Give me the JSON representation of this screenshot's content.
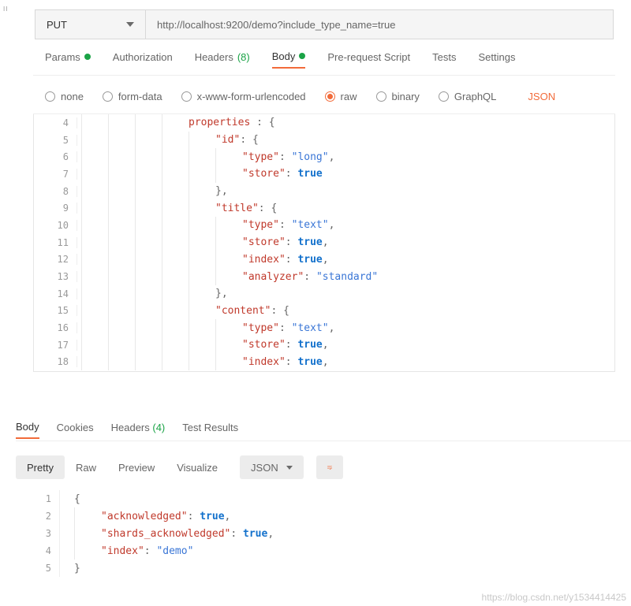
{
  "request": {
    "method": "PUT",
    "url": "http://localhost:9200/demo?include_type_name=true"
  },
  "tabs": {
    "params": "Params",
    "auth": "Authorization",
    "headers": "Headers",
    "headers_count": "(8)",
    "body": "Body",
    "prerequest": "Pre-request Script",
    "tests": "Tests",
    "settings": "Settings"
  },
  "body_type": {
    "none": "none",
    "formdata": "form-data",
    "xwww": "x-www-form-urlencoded",
    "raw": "raw",
    "binary": "binary",
    "graphql": "GraphQL",
    "format": "JSON"
  },
  "req_code": {
    "l4": {
      "n": "4",
      "ind": 4,
      "t": [
        [
          "k",
          "properties"
        ],
        [
          "p",
          " : {"
        ]
      ]
    },
    "l5": {
      "n": "5",
      "ind": 5,
      "t": [
        [
          "k",
          "\"id\""
        ],
        [
          "p",
          ": {"
        ]
      ]
    },
    "l6": {
      "n": "6",
      "ind": 6,
      "t": [
        [
          "k",
          "\"type\""
        ],
        [
          "p",
          ": "
        ],
        [
          "s",
          "\"long\""
        ],
        [
          "p",
          ","
        ]
      ]
    },
    "l7": {
      "n": "7",
      "ind": 6,
      "t": [
        [
          "k",
          "\"store\""
        ],
        [
          "p",
          ": "
        ],
        [
          "kw",
          "true"
        ]
      ]
    },
    "l8": {
      "n": "8",
      "ind": 5,
      "t": [
        [
          "p",
          "},"
        ]
      ]
    },
    "l9": {
      "n": "9",
      "ind": 5,
      "t": [
        [
          "k",
          "\"title\""
        ],
        [
          "p",
          ": {"
        ]
      ]
    },
    "l10": {
      "n": "10",
      "ind": 6,
      "t": [
        [
          "k",
          "\"type\""
        ],
        [
          "p",
          ": "
        ],
        [
          "s",
          "\"text\""
        ],
        [
          "p",
          ","
        ]
      ]
    },
    "l11": {
      "n": "11",
      "ind": 6,
      "t": [
        [
          "k",
          "\"store\""
        ],
        [
          "p",
          ": "
        ],
        [
          "kw",
          "true"
        ],
        [
          "p",
          ","
        ]
      ]
    },
    "l12": {
      "n": "12",
      "ind": 6,
      "t": [
        [
          "k",
          "\"index\""
        ],
        [
          "p",
          ": "
        ],
        [
          "kw",
          "true"
        ],
        [
          "p",
          ","
        ]
      ]
    },
    "l13": {
      "n": "13",
      "ind": 6,
      "t": [
        [
          "k",
          "\"analyzer\""
        ],
        [
          "p",
          ": "
        ],
        [
          "s",
          "\"standard\""
        ]
      ]
    },
    "l14": {
      "n": "14",
      "ind": 5,
      "t": [
        [
          "p",
          "},"
        ]
      ]
    },
    "l15": {
      "n": "15",
      "ind": 5,
      "t": [
        [
          "k",
          "\"content\""
        ],
        [
          "p",
          ": {"
        ]
      ]
    },
    "l16": {
      "n": "16",
      "ind": 6,
      "t": [
        [
          "k",
          "\"type\""
        ],
        [
          "p",
          ": "
        ],
        [
          "s",
          "\"text\""
        ],
        [
          "p",
          ","
        ]
      ]
    },
    "l17": {
      "n": "17",
      "ind": 6,
      "t": [
        [
          "k",
          "\"store\""
        ],
        [
          "p",
          ": "
        ],
        [
          "kw",
          "true"
        ],
        [
          "p",
          ","
        ]
      ]
    },
    "l18": {
      "n": "18",
      "ind": 6,
      "t": [
        [
          "k",
          "\"index\""
        ],
        [
          "p",
          ": "
        ],
        [
          "kw",
          "true"
        ],
        [
          "p",
          ","
        ]
      ]
    }
  },
  "resp_tabs": {
    "body": "Body",
    "cookies": "Cookies",
    "headers": "Headers",
    "headers_count": "(4)",
    "tests": "Test Results"
  },
  "resp_ctrl": {
    "pretty": "Pretty",
    "raw": "Raw",
    "preview": "Preview",
    "visualize": "Visualize",
    "fmt": "JSON"
  },
  "resp_code": {
    "l1": {
      "n": "1",
      "ind": 0,
      "t": [
        [
          "p",
          "{"
        ]
      ]
    },
    "l2": {
      "n": "2",
      "ind": 1,
      "t": [
        [
          "k",
          "\"acknowledged\""
        ],
        [
          "p",
          ": "
        ],
        [
          "kw",
          "true"
        ],
        [
          "p",
          ","
        ]
      ]
    },
    "l3": {
      "n": "3",
      "ind": 1,
      "t": [
        [
          "k",
          "\"shards_acknowledged\""
        ],
        [
          "p",
          ": "
        ],
        [
          "kw",
          "true"
        ],
        [
          "p",
          ","
        ]
      ]
    },
    "l4": {
      "n": "4",
      "ind": 1,
      "t": [
        [
          "k",
          "\"index\""
        ],
        [
          "p",
          ": "
        ],
        [
          "s",
          "\"demo\""
        ]
      ]
    },
    "l5": {
      "n": "5",
      "ind": 0,
      "t": [
        [
          "p",
          "}"
        ]
      ]
    }
  },
  "watermark": "https://blog.csdn.net/y1534414425"
}
